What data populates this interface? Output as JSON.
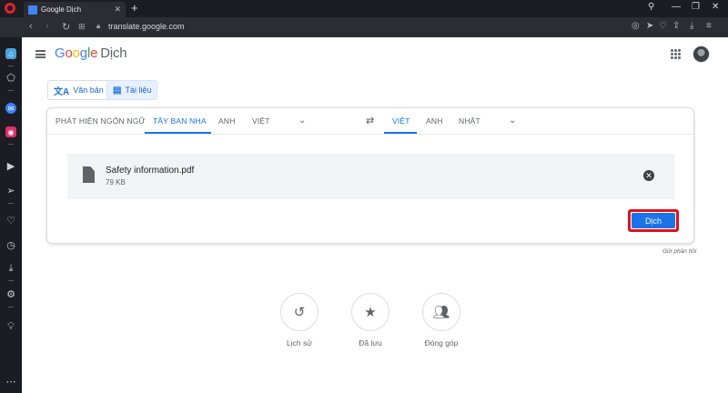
{
  "browser": {
    "tab_title": "Google Dịch",
    "url": "translate.google.com"
  },
  "header": {
    "logo_text": "Google",
    "logo_suffix": "Dịch"
  },
  "modes": {
    "text_label": "Văn bản",
    "document_label": "Tài liệu"
  },
  "source_langs": {
    "detect": "PHÁT HIỆN NGÔN NGỮ",
    "spanish": "TÂY BAN NHA",
    "english": "ANH",
    "vietnamese": "VIỆT"
  },
  "target_langs": {
    "vietnamese": "VIỆT",
    "english": "ANH",
    "japanese": "NHẬT"
  },
  "file": {
    "name": "Safety information.pdf",
    "size": "79 KB"
  },
  "translate_button": "Dịch",
  "feedback": "Gửi phản hồi",
  "bottom": {
    "history": "Lịch sử",
    "saved": "Đã lưu",
    "contribute": "Đóng góp"
  },
  "colors": {
    "accent": "#1a73e8",
    "highlight_border": "#e3111b"
  }
}
